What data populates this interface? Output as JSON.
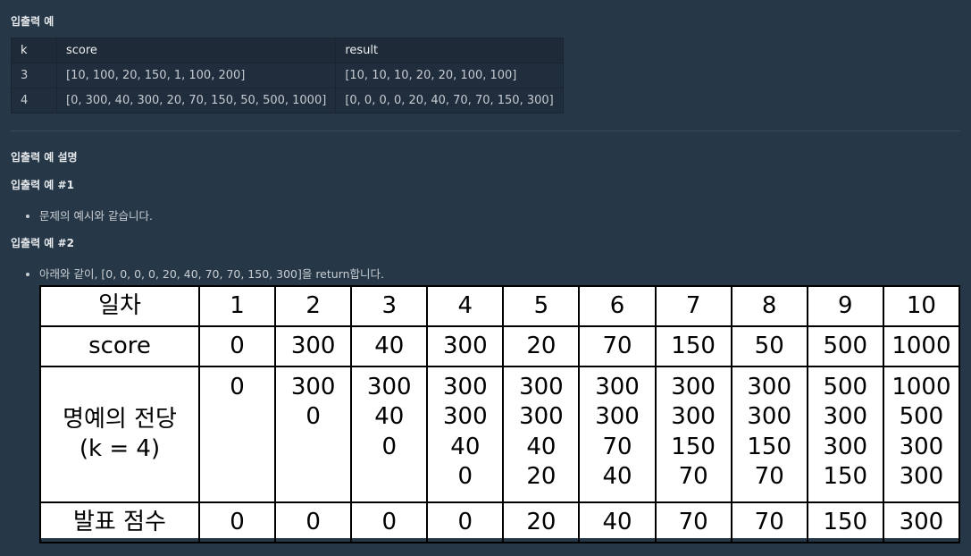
{
  "io_heading": "입출력 예",
  "io_table": {
    "headers": [
      "k",
      "score",
      "result"
    ],
    "rows": [
      [
        "3",
        "[10, 100, 20, 150, 1, 100, 200]",
        "[10, 10, 10, 20, 20, 100, 100]"
      ],
      [
        "4",
        "[0, 300, 40, 300, 20, 70, 150, 50, 500, 1000]",
        "[0, 0, 0, 0, 20, 40, 70, 70, 150, 300]"
      ]
    ]
  },
  "explain_heading": "입출력 예 설명",
  "ex1": {
    "heading": "입출력 예 #1",
    "bullet": "문제의 예시와 같습니다."
  },
  "ex2": {
    "heading": "입출력 예 #2",
    "bullet": "아래와 같이, [0, 0, 0, 0, 20, 40, 70, 70, 150, 300]을 return합니다."
  },
  "hall_table": {
    "day_label": "일차",
    "days": [
      "1",
      "2",
      "3",
      "4",
      "5",
      "6",
      "7",
      "8",
      "9",
      "10"
    ],
    "score_label": "score",
    "scores": [
      "0",
      "300",
      "40",
      "300",
      "20",
      "70",
      "150",
      "50",
      "500",
      "1000"
    ],
    "hall_label_line1": "명예의 전당",
    "hall_label_line2": "(k = 4)",
    "hall": [
      [
        "0"
      ],
      [
        "300",
        "0"
      ],
      [
        "300",
        "40",
        "0"
      ],
      [
        "300",
        "300",
        "40",
        "0"
      ],
      [
        "300",
        "300",
        "40",
        "20"
      ],
      [
        "300",
        "300",
        "70",
        "40"
      ],
      [
        "300",
        "300",
        "150",
        "70"
      ],
      [
        "300",
        "300",
        "150",
        "70"
      ],
      [
        "500",
        "300",
        "300",
        "150"
      ],
      [
        "1000",
        "500",
        "300",
        "300"
      ]
    ],
    "announce_label": "발표 점수",
    "announced": [
      "0",
      "0",
      "0",
      "0",
      "20",
      "40",
      "70",
      "70",
      "150",
      "300"
    ]
  }
}
